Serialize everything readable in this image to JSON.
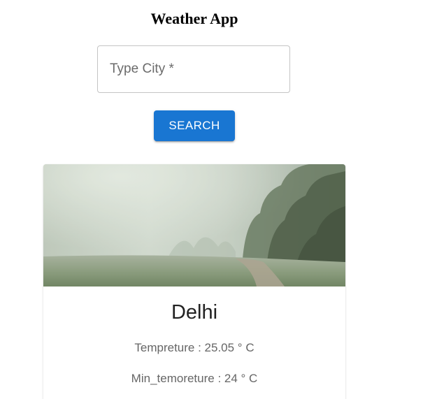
{
  "app": {
    "title": "Weather App"
  },
  "search": {
    "placeholder": "Type City *",
    "value": "",
    "button_label": "SEARCH"
  },
  "card": {
    "image_description": "foggy-field-with-trees",
    "city": "Delhi",
    "temperature_text": "Tempreture : 25.05 ° C",
    "min_temperature_text": "Min_temoreture : 24 ° C"
  },
  "colors": {
    "accent": "#1976d2",
    "title_text": "#000000",
    "body_text": "#666666"
  }
}
